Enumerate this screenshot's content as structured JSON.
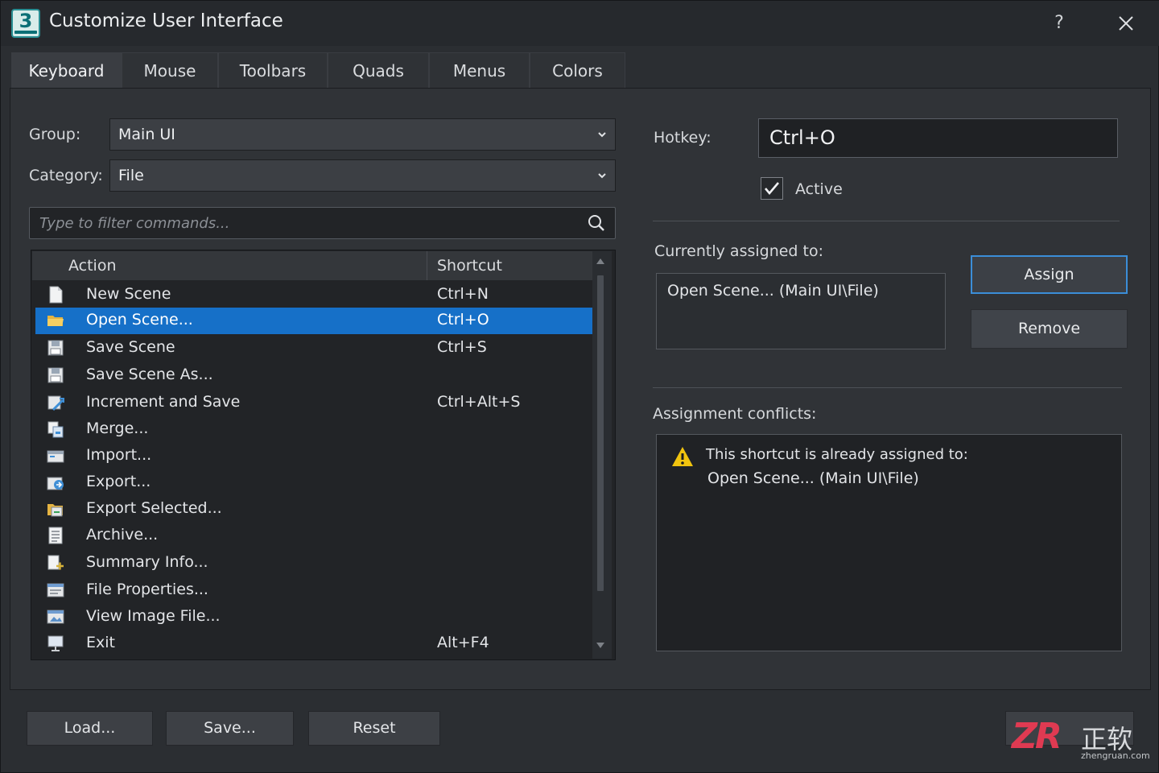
{
  "window": {
    "title": "Customize User Interface",
    "help": "?"
  },
  "tabs": [
    {
      "label": "Keyboard",
      "active": true
    },
    {
      "label": "Mouse",
      "active": false
    },
    {
      "label": "Toolbars",
      "active": false
    },
    {
      "label": "Quads",
      "active": false
    },
    {
      "label": "Menus",
      "active": false
    },
    {
      "label": "Colors",
      "active": false
    }
  ],
  "filters": {
    "group_label": "Group:",
    "group_value": "Main UI",
    "category_label": "Category:",
    "category_value": "File",
    "search_placeholder": "Type to filter commands..."
  },
  "list": {
    "col_action": "Action",
    "col_shortcut": "Shortcut",
    "rows": [
      {
        "name": "New Scene",
        "shortcut": "Ctrl+N",
        "icon": "new-file-icon"
      },
      {
        "name": "Open Scene...",
        "shortcut": "Ctrl+O",
        "icon": "folder-icon",
        "selected": true
      },
      {
        "name": "Save Scene",
        "shortcut": "Ctrl+S",
        "icon": "floppy-disk-icon"
      },
      {
        "name": "Save Scene As...",
        "shortcut": "",
        "icon": "floppy-disk-icon"
      },
      {
        "name": "Increment and Save",
        "shortcut": "Ctrl+Alt+S",
        "icon": "increment-save-icon"
      },
      {
        "name": "Merge...",
        "shortcut": "",
        "icon": "merge-icon"
      },
      {
        "name": "Import...",
        "shortcut": "",
        "icon": "import-icon"
      },
      {
        "name": "Export...",
        "shortcut": "",
        "icon": "export-icon"
      },
      {
        "name": "Export Selected...",
        "shortcut": "",
        "icon": "export-selected-icon"
      },
      {
        "name": "Archive...",
        "shortcut": "",
        "icon": "archive-icon"
      },
      {
        "name": "Summary Info...",
        "shortcut": "",
        "icon": "summary-info-icon"
      },
      {
        "name": "File Properties...",
        "shortcut": "",
        "icon": "file-properties-icon"
      },
      {
        "name": "View Image File...",
        "shortcut": "",
        "icon": "view-image-icon"
      },
      {
        "name": "Exit",
        "shortcut": "Alt+F4",
        "icon": "exit-icon"
      }
    ]
  },
  "hotkey": {
    "label": "Hotkey:",
    "value": "Ctrl+O",
    "active_label": "Active",
    "active_checked": true
  },
  "assigned": {
    "label": "Currently assigned to:",
    "value": "Open Scene... (Main UI\\File)",
    "assign_button": "Assign",
    "remove_button": "Remove"
  },
  "conflicts": {
    "label": "Assignment conflicts:",
    "message": "This shortcut is already assigned to:",
    "target": "Open Scene... (Main UI\\File)"
  },
  "footer": {
    "load_button": "Load...",
    "save_button": "Save...",
    "reset_button": "Reset"
  },
  "watermark": {
    "logo": "ZR",
    "name": "正软",
    "url": "zhengruan.com"
  },
  "colors": {
    "selection": "#1670c8",
    "primary_button_border": "#3b8ed8",
    "warning": "#f1c40f",
    "watermark": "#e03a52"
  }
}
